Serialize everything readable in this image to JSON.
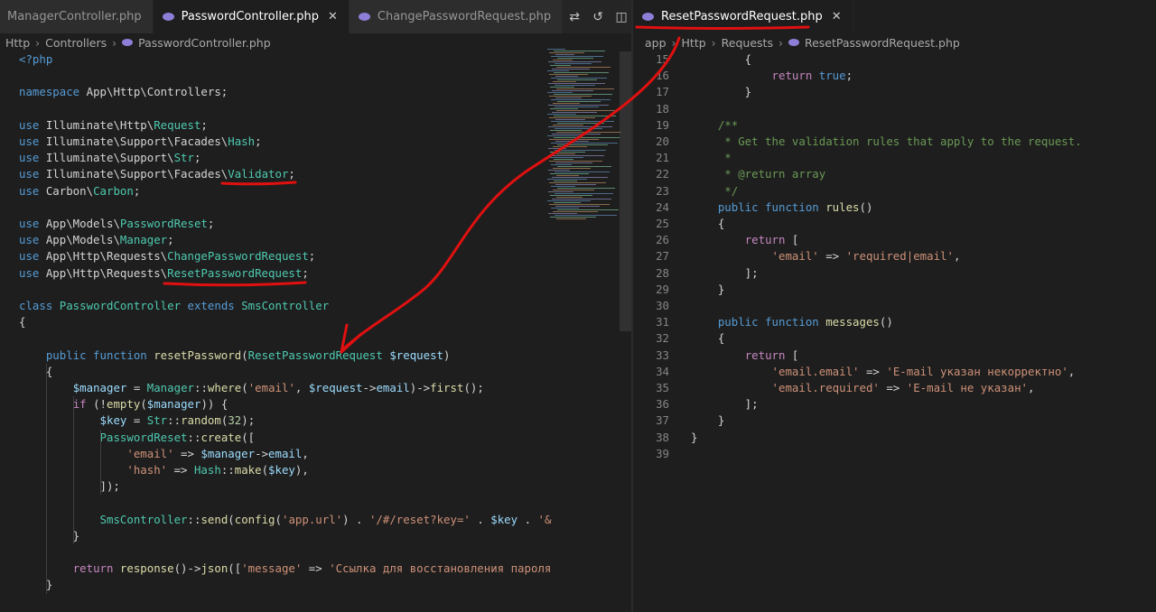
{
  "left": {
    "tabs": [
      {
        "label": "ManagerController.php",
        "active": false
      },
      {
        "label": "PasswordController.php",
        "active": true
      },
      {
        "label": "ChangePasswordRequest.php",
        "active": false
      }
    ],
    "actions": [
      {
        "name": "compare-changes-icon",
        "glyph": "⇄"
      },
      {
        "name": "history-icon",
        "glyph": "↺"
      },
      {
        "name": "split-editor-icon",
        "glyph": "◫"
      },
      {
        "name": "more-actions-icon",
        "glyph": "···"
      }
    ],
    "breadcrumb": [
      "Http",
      "Controllers",
      "PasswordController.php"
    ]
  },
  "right": {
    "tab": {
      "label": "ResetPasswordRequest.php",
      "close": "✕"
    },
    "breadcrumb": [
      "app",
      "Http",
      "Requests",
      "ResetPasswordRequest.php"
    ],
    "line_numbers": [
      15,
      16,
      17,
      18,
      19,
      20,
      21,
      22,
      23,
      24,
      25,
      26,
      27,
      28,
      29,
      30,
      31,
      32,
      33,
      34,
      35,
      36,
      37,
      38,
      39
    ]
  },
  "code_left": [
    [
      [
        "kw",
        "<?php"
      ]
    ],
    [],
    [
      [
        "kw",
        "namespace "
      ],
      [
        "op",
        "App\\Http\\Controllers;"
      ]
    ],
    [],
    [
      [
        "kw",
        "use "
      ],
      [
        "op",
        "Illuminate\\Http\\"
      ],
      [
        "cls",
        "Request"
      ],
      [
        "op",
        ";"
      ]
    ],
    [
      [
        "kw",
        "use "
      ],
      [
        "op",
        "Illuminate\\Support\\Facades\\"
      ],
      [
        "cls",
        "Hash"
      ],
      [
        "op",
        ";"
      ]
    ],
    [
      [
        "kw",
        "use "
      ],
      [
        "op",
        "Illuminate\\Support\\"
      ],
      [
        "cls",
        "Str"
      ],
      [
        "op",
        ";"
      ]
    ],
    [
      [
        "kw",
        "use "
      ],
      [
        "op",
        "Illuminate\\Support\\Facades\\"
      ],
      [
        "cls",
        "Validator"
      ],
      [
        "op",
        ";"
      ]
    ],
    [
      [
        "kw",
        "use "
      ],
      [
        "op",
        "Carbon\\"
      ],
      [
        "cls",
        "Carbon"
      ],
      [
        "op",
        ";"
      ]
    ],
    [],
    [
      [
        "kw",
        "use "
      ],
      [
        "op",
        "App\\Models\\"
      ],
      [
        "cls",
        "PasswordReset"
      ],
      [
        "op",
        ";"
      ]
    ],
    [
      [
        "kw",
        "use "
      ],
      [
        "op",
        "App\\Models\\"
      ],
      [
        "cls",
        "Manager"
      ],
      [
        "op",
        ";"
      ]
    ],
    [
      [
        "kw",
        "use "
      ],
      [
        "op",
        "App\\Http\\Requests\\"
      ],
      [
        "cls",
        "ChangePasswordRequest"
      ],
      [
        "op",
        ";"
      ]
    ],
    [
      [
        "kw",
        "use "
      ],
      [
        "op",
        "App\\Http\\Requests\\"
      ],
      [
        "cls",
        "ResetPasswordRequest"
      ],
      [
        "op",
        ";"
      ]
    ],
    [],
    [
      [
        "kw",
        "class "
      ],
      [
        "cls",
        "PasswordController "
      ],
      [
        "kw",
        "extends "
      ],
      [
        "cls",
        "SmsController"
      ]
    ],
    [
      [
        "op",
        "{"
      ]
    ],
    [],
    [
      [
        "op",
        "    "
      ],
      [
        "kw",
        "public function "
      ],
      [
        "fn",
        "resetPassword"
      ],
      [
        "op",
        "("
      ],
      [
        "cls",
        "ResetPasswordRequest "
      ],
      [
        "var",
        "$request"
      ],
      [
        "op",
        ")"
      ]
    ],
    [
      [
        "op",
        "    {"
      ]
    ],
    [
      [
        "op",
        "        "
      ],
      [
        "var",
        "$manager"
      ],
      [
        "op",
        " = "
      ],
      [
        "cls",
        "Manager"
      ],
      [
        "op",
        "::"
      ],
      [
        "fn",
        "where"
      ],
      [
        "op",
        "("
      ],
      [
        "str",
        "'email'"
      ],
      [
        "op",
        ", "
      ],
      [
        "var",
        "$request"
      ],
      [
        "op",
        "->"
      ],
      [
        "var",
        "email"
      ],
      [
        "op",
        ")->"
      ],
      [
        "fn",
        "first"
      ],
      [
        "op",
        "();"
      ]
    ],
    [
      [
        "op",
        "        "
      ],
      [
        "ctl",
        "if "
      ],
      [
        "op",
        "(!"
      ],
      [
        "fn",
        "empty"
      ],
      [
        "op",
        "("
      ],
      [
        "var",
        "$manager"
      ],
      [
        "op",
        ")) {"
      ]
    ],
    [
      [
        "op",
        "            "
      ],
      [
        "var",
        "$key"
      ],
      [
        "op",
        " = "
      ],
      [
        "cls",
        "Str"
      ],
      [
        "op",
        "::"
      ],
      [
        "fn",
        "random"
      ],
      [
        "op",
        "("
      ],
      [
        "num",
        "32"
      ],
      [
        "op",
        ");"
      ]
    ],
    [
      [
        "op",
        "            "
      ],
      [
        "cls",
        "PasswordReset"
      ],
      [
        "op",
        "::"
      ],
      [
        "fn",
        "create"
      ],
      [
        "op",
        "(["
      ]
    ],
    [
      [
        "op",
        "                "
      ],
      [
        "str",
        "'email'"
      ],
      [
        "op",
        " => "
      ],
      [
        "var",
        "$manager"
      ],
      [
        "op",
        "->"
      ],
      [
        "var",
        "email"
      ],
      [
        "op",
        ","
      ]
    ],
    [
      [
        "op",
        "                "
      ],
      [
        "str",
        "'hash'"
      ],
      [
        "op",
        " => "
      ],
      [
        "cls",
        "Hash"
      ],
      [
        "op",
        "::"
      ],
      [
        "fn",
        "make"
      ],
      [
        "op",
        "("
      ],
      [
        "var",
        "$key"
      ],
      [
        "op",
        "),"
      ]
    ],
    [
      [
        "op",
        "            ]);"
      ]
    ],
    [],
    [
      [
        "op",
        "            "
      ],
      [
        "cls",
        "SmsController"
      ],
      [
        "op",
        "::"
      ],
      [
        "fn",
        "send"
      ],
      [
        "op",
        "("
      ],
      [
        "fn",
        "config"
      ],
      [
        "op",
        "("
      ],
      [
        "str",
        "'app.url'"
      ],
      [
        "op",
        ") . "
      ],
      [
        "str",
        "'/#/reset?key='"
      ],
      [
        "op",
        " . "
      ],
      [
        "var",
        "$key"
      ],
      [
        "op",
        " . "
      ],
      [
        "str",
        "'&"
      ]
    ],
    [
      [
        "op",
        "        }"
      ]
    ],
    [],
    [
      [
        "op",
        "        "
      ],
      [
        "ctl",
        "return "
      ],
      [
        "fn",
        "response"
      ],
      [
        "op",
        "()->"
      ],
      [
        "fn",
        "json"
      ],
      [
        "op",
        "(["
      ],
      [
        "str",
        "'message'"
      ],
      [
        "op",
        " => "
      ],
      [
        "str",
        "'Ссылка для восстановления пароля"
      ]
    ],
    [
      [
        "op",
        "    }"
      ]
    ]
  ],
  "code_right": [
    [
      [
        "op",
        "        {"
      ]
    ],
    [
      [
        "op",
        "            "
      ],
      [
        "ctl",
        "return "
      ],
      [
        "kw",
        "true"
      ],
      [
        "op",
        ";"
      ]
    ],
    [
      [
        "op",
        "        }"
      ]
    ],
    [],
    [
      [
        "op",
        "    "
      ],
      [
        "cmt",
        "/**"
      ]
    ],
    [
      [
        "op",
        "    "
      ],
      [
        "cmt",
        " * Get the validation rules that apply to the request."
      ]
    ],
    [
      [
        "op",
        "    "
      ],
      [
        "cmt",
        " *"
      ]
    ],
    [
      [
        "op",
        "    "
      ],
      [
        "cmt",
        " * @return array"
      ]
    ],
    [
      [
        "op",
        "    "
      ],
      [
        "cmt",
        " */"
      ]
    ],
    [
      [
        "op",
        "    "
      ],
      [
        "kw",
        "public function "
      ],
      [
        "fn",
        "rules"
      ],
      [
        "op",
        "()"
      ]
    ],
    [
      [
        "op",
        "    {"
      ]
    ],
    [
      [
        "op",
        "        "
      ],
      [
        "ctl",
        "return "
      ],
      [
        "op",
        "["
      ]
    ],
    [
      [
        "op",
        "            "
      ],
      [
        "str",
        "'email'"
      ],
      [
        "op",
        " => "
      ],
      [
        "str",
        "'required|email'"
      ],
      [
        "op",
        ","
      ]
    ],
    [
      [
        "op",
        "        ];"
      ]
    ],
    [
      [
        "op",
        "    }"
      ]
    ],
    [],
    [
      [
        "op",
        "    "
      ],
      [
        "kw",
        "public function "
      ],
      [
        "fn",
        "messages"
      ],
      [
        "op",
        "()"
      ]
    ],
    [
      [
        "op",
        "    {"
      ]
    ],
    [
      [
        "op",
        "        "
      ],
      [
        "ctl",
        "return "
      ],
      [
        "op",
        "["
      ]
    ],
    [
      [
        "op",
        "            "
      ],
      [
        "str",
        "'email.email'"
      ],
      [
        "op",
        " => "
      ],
      [
        "str",
        "'E-mail указан некорректно'"
      ],
      [
        "op",
        ","
      ]
    ],
    [
      [
        "op",
        "            "
      ],
      [
        "str",
        "'email.required'"
      ],
      [
        "op",
        " => "
      ],
      [
        "str",
        "'E-mail не указан'"
      ],
      [
        "op",
        ","
      ]
    ],
    [
      [
        "op",
        "        ];"
      ]
    ],
    [
      [
        "op",
        "    }"
      ]
    ],
    [
      [
        "op",
        "}"
      ]
    ],
    []
  ],
  "annotation": {
    "color": "#e01010"
  }
}
